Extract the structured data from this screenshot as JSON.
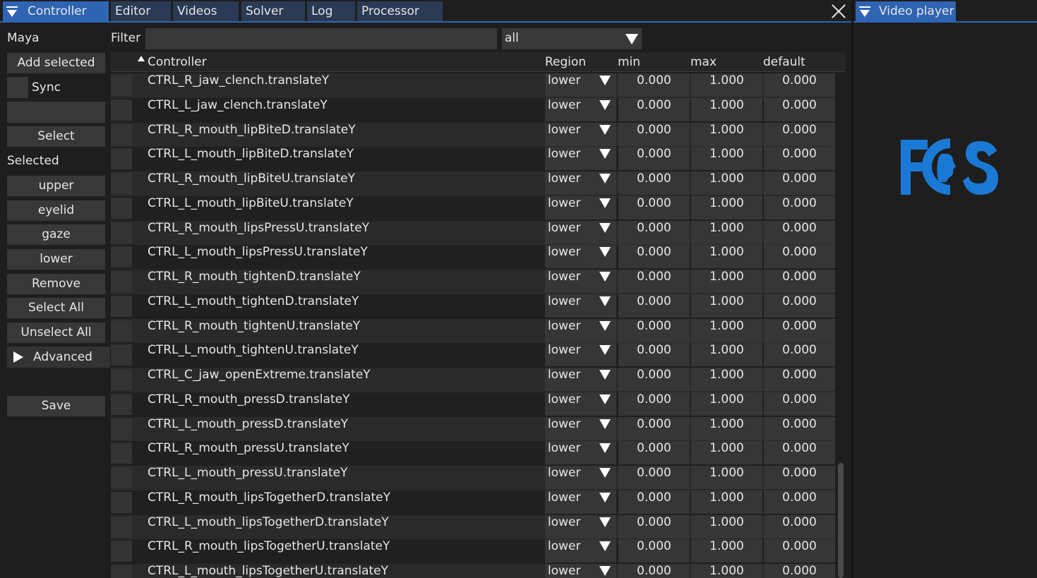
{
  "tabs": [
    {
      "label": "Controller"
    },
    {
      "label": "Editor"
    },
    {
      "label": "Videos"
    },
    {
      "label": "Solver"
    },
    {
      "label": "Log"
    },
    {
      "label": "Processor"
    }
  ],
  "video_player": {
    "tab_label": "Video player",
    "logo_text": "FACS"
  },
  "sidebar": {
    "maya_label": "Maya",
    "add_selected": "Add selected",
    "sync_label": "Sync",
    "select": "Select",
    "selected_label": "Selected",
    "regions": [
      "upper",
      "eyelid",
      "gaze",
      "lower"
    ],
    "remove": "Remove",
    "select_all": "Select All",
    "unselect_all": "Unselect All",
    "advanced": "Advanced",
    "save": "Save"
  },
  "filter": {
    "label": "Filter",
    "value": "",
    "selected_option": "all"
  },
  "table": {
    "headers": {
      "controller": "Controller",
      "region": "Region",
      "min": "min",
      "max": "max",
      "default": "default"
    },
    "rows": [
      {
        "name": "CTRL_R_jaw_clench.translateY",
        "region": "lower",
        "min": "0.000",
        "max": "1.000",
        "default": "0.000"
      },
      {
        "name": "CTRL_L_jaw_clench.translateY",
        "region": "lower",
        "min": "0.000",
        "max": "1.000",
        "default": "0.000"
      },
      {
        "name": "CTRL_R_mouth_lipBiteD.translateY",
        "region": "lower",
        "min": "0.000",
        "max": "1.000",
        "default": "0.000"
      },
      {
        "name": "CTRL_L_mouth_lipBiteD.translateY",
        "region": "lower",
        "min": "0.000",
        "max": "1.000",
        "default": "0.000"
      },
      {
        "name": "CTRL_R_mouth_lipBiteU.translateY",
        "region": "lower",
        "min": "0.000",
        "max": "1.000",
        "default": "0.000"
      },
      {
        "name": "CTRL_L_mouth_lipBiteU.translateY",
        "region": "lower",
        "min": "0.000",
        "max": "1.000",
        "default": "0.000"
      },
      {
        "name": "CTRL_R_mouth_lipsPressU.translateY",
        "region": "lower",
        "min": "0.000",
        "max": "1.000",
        "default": "0.000"
      },
      {
        "name": "CTRL_L_mouth_lipsPressU.translateY",
        "region": "lower",
        "min": "0.000",
        "max": "1.000",
        "default": "0.000"
      },
      {
        "name": "CTRL_R_mouth_tightenD.translateY",
        "region": "lower",
        "min": "0.000",
        "max": "1.000",
        "default": "0.000"
      },
      {
        "name": "CTRL_L_mouth_tightenD.translateY",
        "region": "lower",
        "min": "0.000",
        "max": "1.000",
        "default": "0.000"
      },
      {
        "name": "CTRL_R_mouth_tightenU.translateY",
        "region": "lower",
        "min": "0.000",
        "max": "1.000",
        "default": "0.000"
      },
      {
        "name": "CTRL_L_mouth_tightenU.translateY",
        "region": "lower",
        "min": "0.000",
        "max": "1.000",
        "default": "0.000"
      },
      {
        "name": "CTRL_C_jaw_openExtreme.translateY",
        "region": "lower",
        "min": "0.000",
        "max": "1.000",
        "default": "0.000"
      },
      {
        "name": "CTRL_R_mouth_pressD.translateY",
        "region": "lower",
        "min": "0.000",
        "max": "1.000",
        "default": "0.000"
      },
      {
        "name": "CTRL_L_mouth_pressD.translateY",
        "region": "lower",
        "min": "0.000",
        "max": "1.000",
        "default": "0.000"
      },
      {
        "name": "CTRL_R_mouth_pressU.translateY",
        "region": "lower",
        "min": "0.000",
        "max": "1.000",
        "default": "0.000"
      },
      {
        "name": "CTRL_L_mouth_pressU.translateY",
        "region": "lower",
        "min": "0.000",
        "max": "1.000",
        "default": "0.000"
      },
      {
        "name": "CTRL_R_mouth_lipsTogetherD.translateY",
        "region": "lower",
        "min": "0.000",
        "max": "1.000",
        "default": "0.000"
      },
      {
        "name": "CTRL_L_mouth_lipsTogetherD.translateY",
        "region": "lower",
        "min": "0.000",
        "max": "1.000",
        "default": "0.000"
      },
      {
        "name": "CTRL_R_mouth_lipsTogetherU.translateY",
        "region": "lower",
        "min": "0.000",
        "max": "1.000",
        "default": "0.000"
      },
      {
        "name": "CTRL_L_mouth_lipsTogetherU.translateY",
        "region": "lower",
        "min": "0.000",
        "max": "1.000",
        "default": "0.000"
      }
    ]
  },
  "colors": {
    "accent": "#2f64b3",
    "logo": "#1b79d6",
    "background": "#1e1e1e"
  }
}
